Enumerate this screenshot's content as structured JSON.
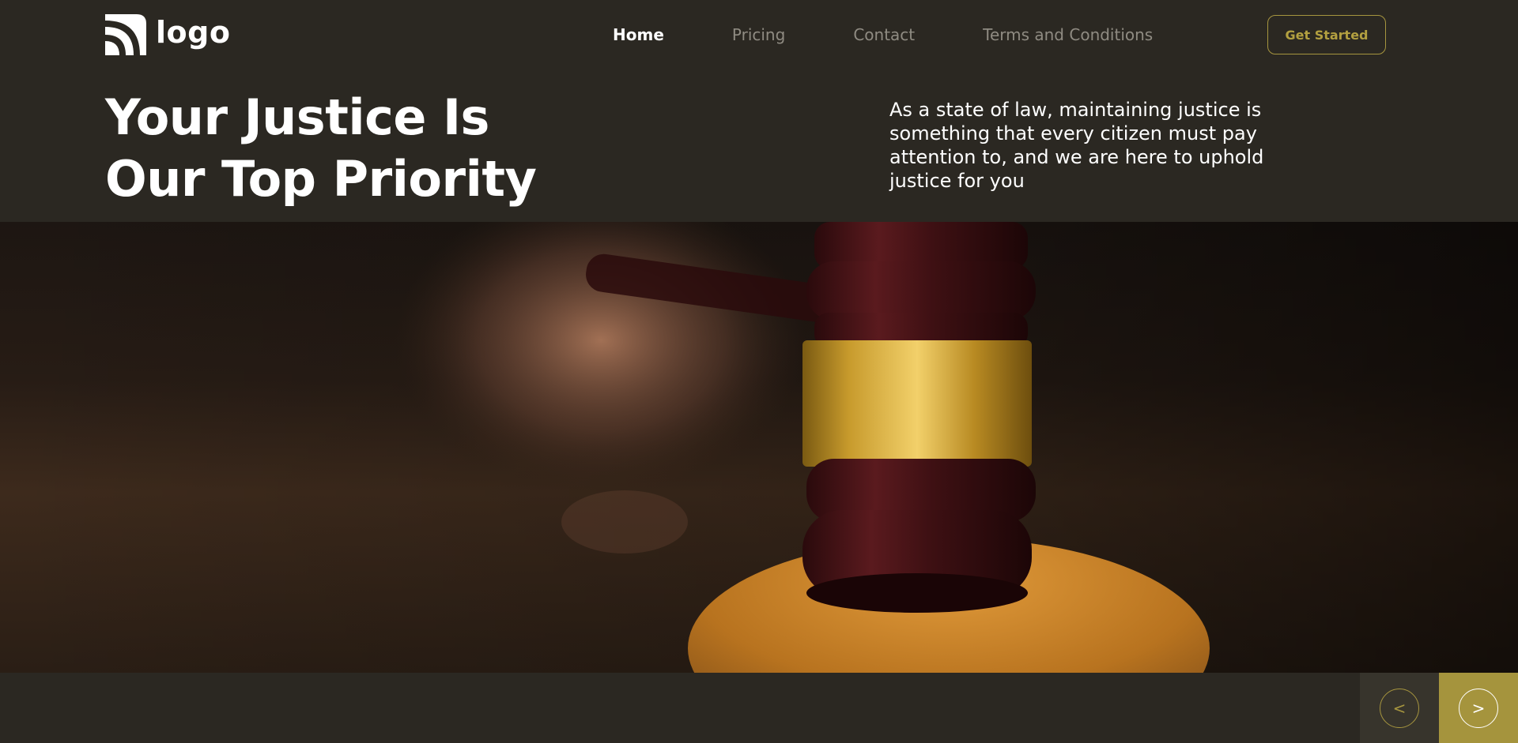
{
  "header": {
    "logo_text": "logo",
    "nav": [
      "Home",
      "Pricing",
      "Contact",
      "Terms and Conditions"
    ],
    "active_nav": "Home",
    "cta_label": "Get Started"
  },
  "hero": {
    "title_line1": "Your Justice Is",
    "title_line2": "Our Top Priority",
    "description": "As a state of law, maintaining justice is something that every citizen must pay attention to, and we are here to uphold justice for you"
  },
  "slider": {
    "prev_label": "<",
    "next_label": ">"
  },
  "colors": {
    "background": "#2b2822",
    "accent": "#a5943d",
    "text": "#ffffff",
    "nav_muted": "#8f8b82"
  }
}
